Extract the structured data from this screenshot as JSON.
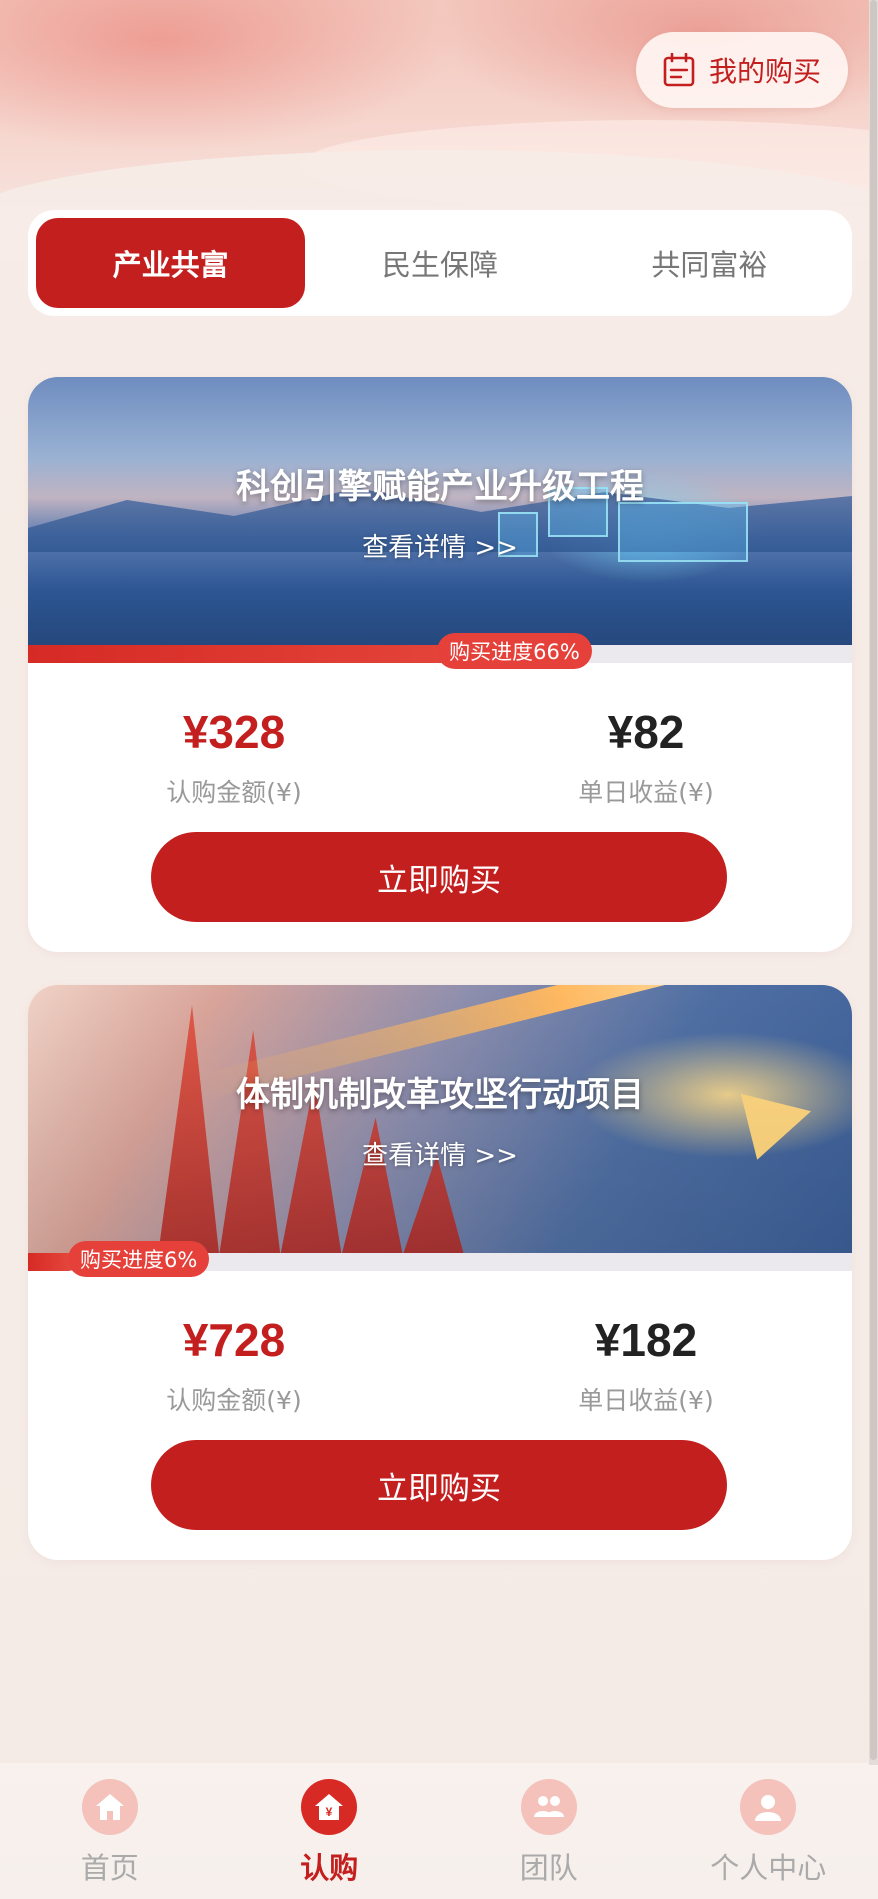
{
  "header": {
    "my_purchase_label": "我的购买",
    "my_purchase_icon": "calendar-list-icon"
  },
  "tabs": [
    {
      "label": "产业共富",
      "active": true
    },
    {
      "label": "民生保障",
      "active": false
    },
    {
      "label": "共同富裕",
      "active": false
    }
  ],
  "products": [
    {
      "title": "科创引擎赋能产业升级工程",
      "detail_link": "查看详情 >>",
      "progress_label": "购买进度66%",
      "progress": 0.66,
      "amount": "¥328",
      "amount_label": "认购金额(¥)",
      "daily_income": "¥82",
      "daily_income_label": "单日收益(¥)",
      "buy_label": "立即购买"
    },
    {
      "title": "体制机制改革攻坚行动项目",
      "detail_link": "查看详情 >>",
      "progress_label": "购买进度6%",
      "progress": 0.06,
      "amount": "¥728",
      "amount_label": "认购金额(¥)",
      "daily_income": "¥182",
      "daily_income_label": "单日收益(¥)",
      "buy_label": "立即购买"
    }
  ],
  "bottom_nav": [
    {
      "label": "首页",
      "icon": "home-icon",
      "active": false
    },
    {
      "label": "认购",
      "icon": "yen-house-icon",
      "active": true
    },
    {
      "label": "团队",
      "icon": "team-icon",
      "active": false
    },
    {
      "label": "个人中心",
      "icon": "user-icon",
      "active": false
    }
  ],
  "colors": {
    "primary": "#c41f1f",
    "progress": "#e5413a",
    "muted_text": "#999999"
  }
}
